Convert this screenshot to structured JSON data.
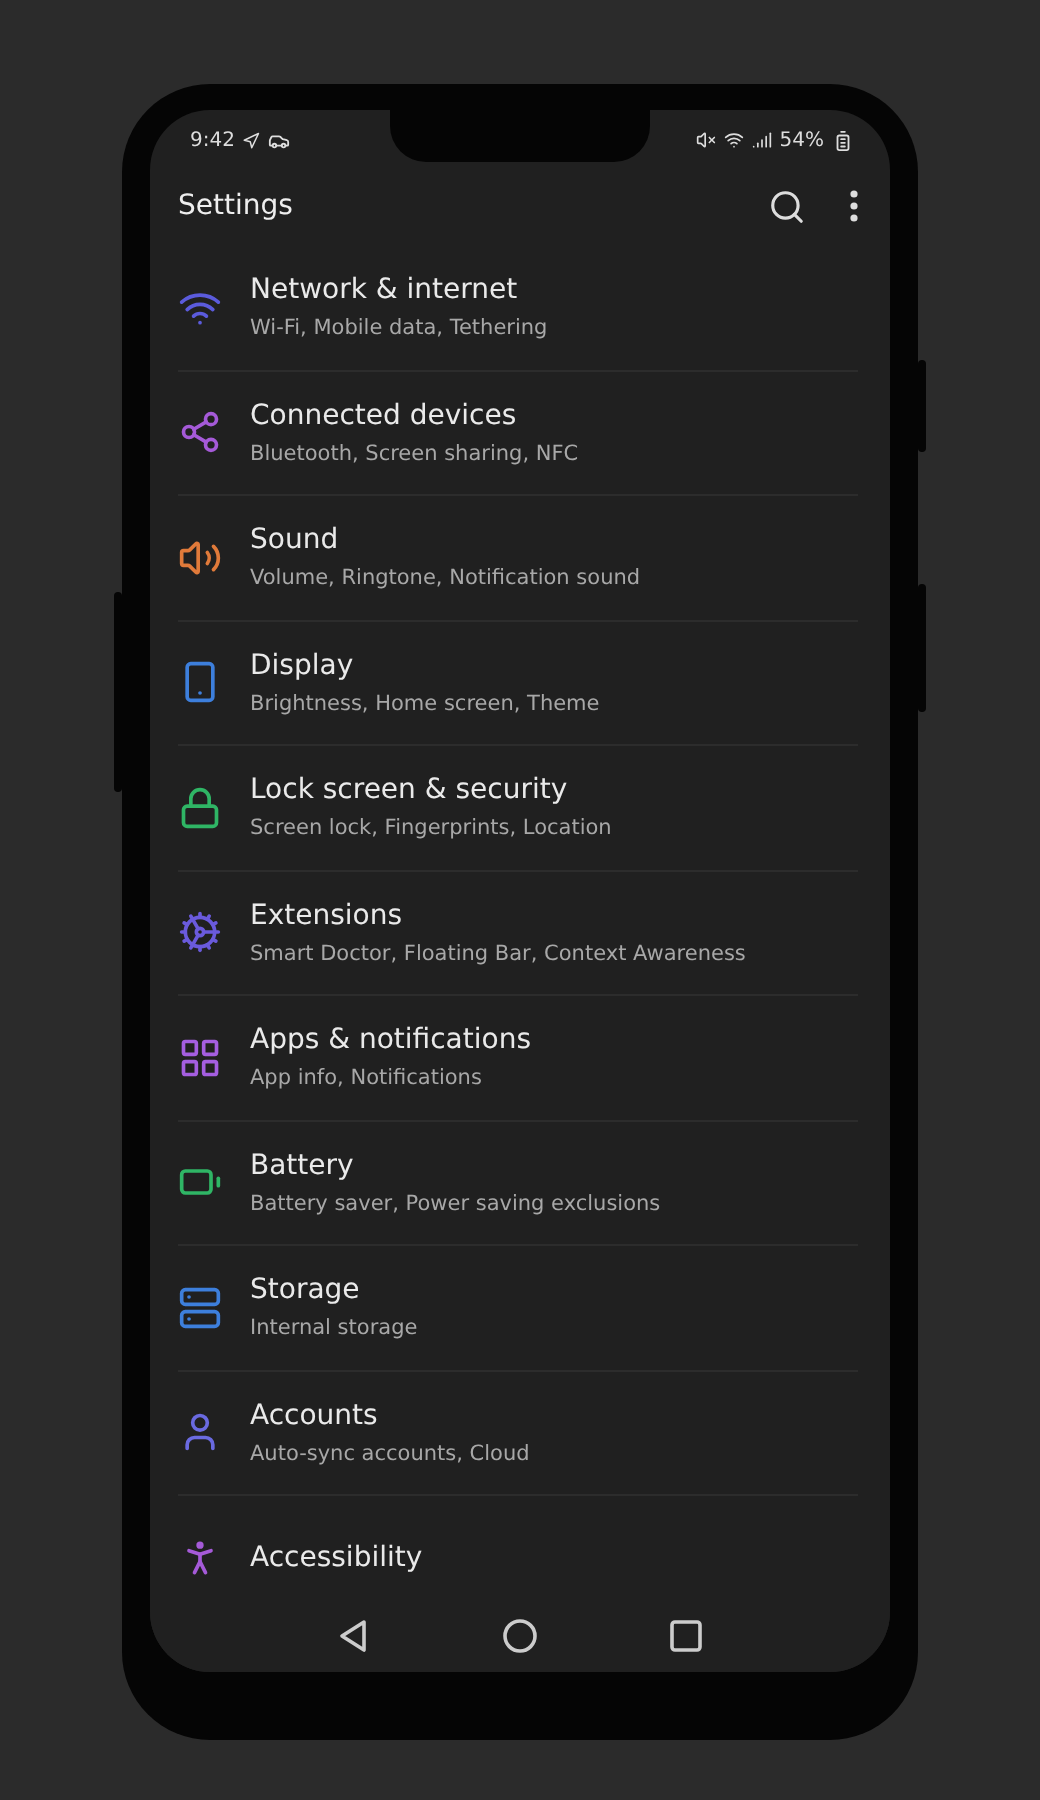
{
  "status_bar": {
    "time": "9:42",
    "battery": "54%"
  },
  "header": {
    "title": "Settings"
  },
  "items": [
    {
      "title": "Network & internet",
      "subtitle": "Wi-Fi, Mobile data, Tethering",
      "color": "#5b5bdc"
    },
    {
      "title": "Connected devices",
      "subtitle": "Bluetooth, Screen sharing, NFC",
      "color": "#a55ad8"
    },
    {
      "title": "Sound",
      "subtitle": "Volume, Ringtone, Notification sound",
      "color": "#e07a3a"
    },
    {
      "title": "Display",
      "subtitle": "Brightness, Home screen, Theme",
      "color": "#3d7fdc"
    },
    {
      "title": "Lock screen & security",
      "subtitle": "Screen lock, Fingerprints, Location",
      "color": "#2fb565"
    },
    {
      "title": "Extensions",
      "subtitle": "Smart Doctor, Floating Bar, Context Awareness",
      "color": "#6a5adc"
    },
    {
      "title": "Apps & notifications",
      "subtitle": "App info, Notifications",
      "color": "#a55ee0"
    },
    {
      "title": "Battery",
      "subtitle": "Battery saver, Power saving exclusions",
      "color": "#2fb565"
    },
    {
      "title": "Storage",
      "subtitle": "Internal storage",
      "color": "#3d7fdc"
    },
    {
      "title": "Accounts",
      "subtitle": "Auto-sync accounts, Cloud",
      "color": "#6a6ae0"
    },
    {
      "title": "Accessibility",
      "color": "#a55ad8"
    }
  ]
}
